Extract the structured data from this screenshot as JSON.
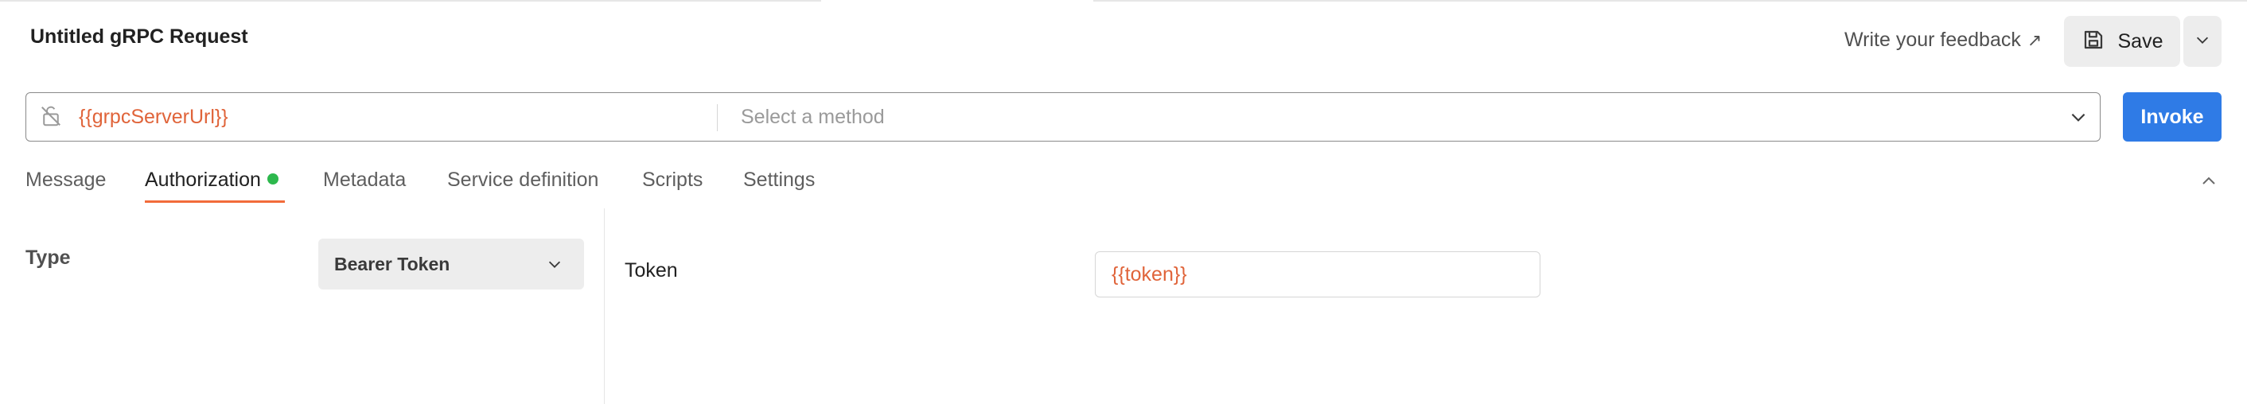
{
  "request": {
    "title": "Untitled gRPC Request"
  },
  "header": {
    "feedback_label": "Write your feedback",
    "feedback_arrow": "↗",
    "save_label": "Save"
  },
  "url_bar": {
    "server_url": "{{grpcServerUrl}}",
    "method_placeholder": "Select a method",
    "invoke_label": "Invoke"
  },
  "tabs": [
    {
      "label": "Message",
      "active": false
    },
    {
      "label": "Authorization",
      "active": true,
      "indicator": "green-dot"
    },
    {
      "label": "Metadata",
      "active": false
    },
    {
      "label": "Service definition",
      "active": false
    },
    {
      "label": "Scripts",
      "active": false
    },
    {
      "label": "Settings",
      "active": false
    }
  ],
  "auth": {
    "type_label": "Type",
    "type_value": "Bearer Token",
    "token_label": "Token",
    "token_value": "{{token}}"
  },
  "colors": {
    "accent_orange": "#e0643a",
    "tab_underline": "#f26b3a",
    "invoke_blue": "#2f7be6",
    "status_green": "#2db84d"
  },
  "icons": [
    "save-icon",
    "chevron-down-icon",
    "lock-off-icon",
    "chevron-up-icon",
    "arrow-up-right-icon"
  ]
}
